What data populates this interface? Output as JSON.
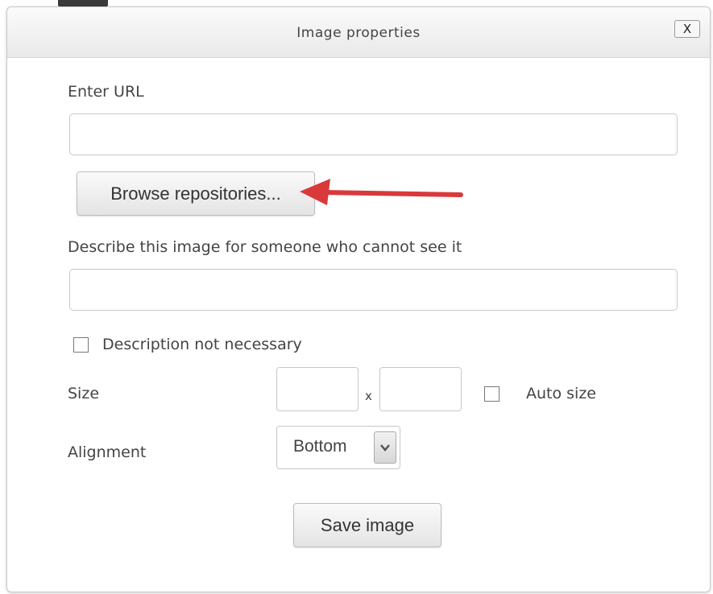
{
  "dialog": {
    "title": "Image properties",
    "close_label": "X"
  },
  "form": {
    "url_label": "Enter URL",
    "url_value": "",
    "browse_button": "Browse repositories...",
    "description_label": "Describe this image for someone who cannot see it",
    "description_value": "",
    "description_not_necessary_label": "Description not necessary",
    "description_not_necessary_checked": false,
    "size_label": "Size",
    "size_separator": "x",
    "width_value": "",
    "height_value": "",
    "auto_size_label": "Auto size",
    "auto_size_checked": false,
    "alignment_label": "Alignment",
    "alignment_value": "Bottom",
    "save_button": "Save image"
  },
  "annotation": {
    "arrow_color": "#d9393b",
    "arrow_target": "browse-repositories-button"
  }
}
